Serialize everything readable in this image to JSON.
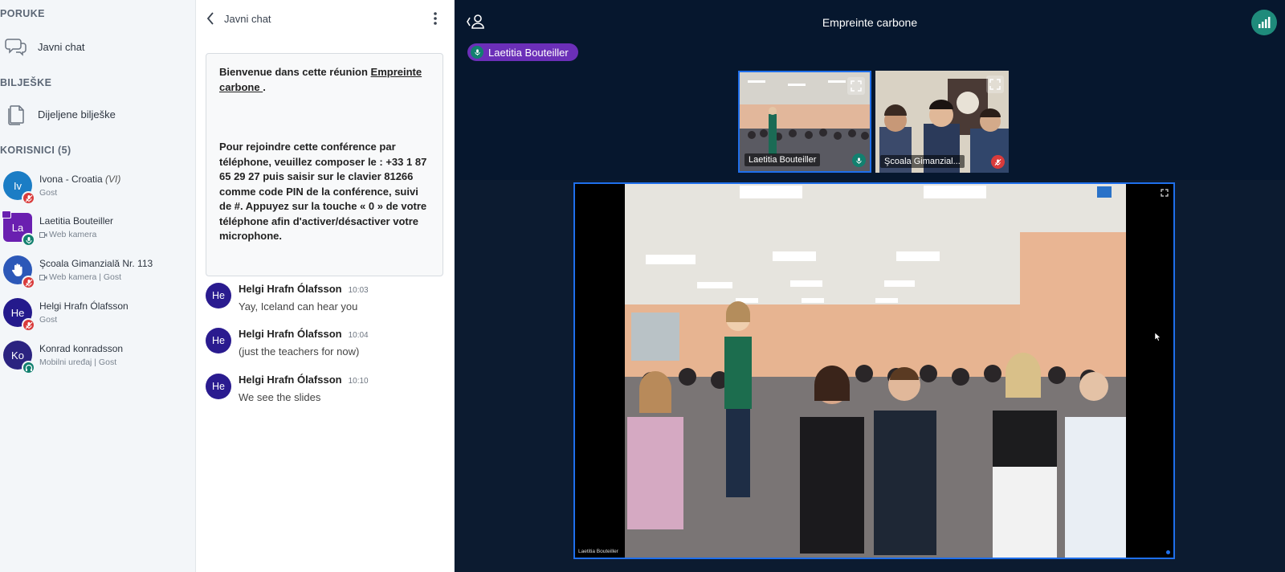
{
  "sidebar": {
    "messages_heading": "PORUKE",
    "public_chat_label": "Javni chat",
    "notes_heading": "BILJEŠKE",
    "shared_notes_label": "Dijeljene bilješke",
    "users_heading": "KORISNICI (5)",
    "users": [
      {
        "initials": "Iv",
        "name": "Ivona - Croatia",
        "tag": "(VI)",
        "sub": "Gost",
        "color": "#1b7dc5",
        "status": "muted"
      },
      {
        "initials": "La",
        "name": "Laetitia Bouteiller",
        "tag": "",
        "sub": "Web kamera",
        "color": "#6a1fb0",
        "status": "live"
      },
      {
        "initials": "",
        "name": "Şcoala Gimanzială Nr. 113",
        "tag": "",
        "sub": "Web kamera | Gost",
        "color": "#2c58b8",
        "status": "muted"
      },
      {
        "initials": "He",
        "name": "Helgi Hrafn Ólafsson",
        "tag": "",
        "sub": "Gost",
        "color": "#241a8c",
        "status": "muted"
      },
      {
        "initials": "Ko",
        "name": "Konrad konradsson",
        "tag": "",
        "sub": "Mobilni uređaj | Gost",
        "color": "#2b2380",
        "status": "headset"
      }
    ]
  },
  "chat": {
    "title": "Javni chat",
    "welcome": {
      "line1_prefix": "Bienvenue dans cette réunion ",
      "line1_link": "Empreinte carbone ",
      "line1_suffix": ".",
      "body": "Pour rejoindre cette conférence par téléphone, veuillez composer le : +33 1 87 65 29 27 puis saisir sur le clavier 81266 comme code PIN de la conférence, suivi de #. Appuyez sur la touche « 0 » de votre téléphone afin d'activer/désactiver votre microphone."
    },
    "messages": [
      {
        "initials": "He",
        "author": "Helgi Hrafn Ólafsson",
        "time": "10:03",
        "text": "Yay, Iceland can hear you"
      },
      {
        "initials": "He",
        "author": "Helgi Hrafn Ólafsson",
        "time": "10:04",
        "text": "(just the teachers for now)"
      },
      {
        "initials": "He",
        "author": "Helgi Hrafn Ólafsson",
        "time": "10:10",
        "text": "We see the slides"
      }
    ]
  },
  "meeting": {
    "title": "Empreinte carbone",
    "talking_indicator": "Laetitia Bouteiller",
    "cameras": [
      {
        "name": "Laetitia Bouteiller",
        "mic": "live"
      },
      {
        "name": "Şcoala Gimanzial...",
        "mic": "muted"
      }
    ],
    "presenter_label": "Laetitia Bouteiller"
  },
  "colors": {
    "accent_blue": "#1f6feb",
    "talking_purple": "#6b2fb8",
    "status_green": "#1f8b7b",
    "muted_red": "#d93b3b"
  }
}
